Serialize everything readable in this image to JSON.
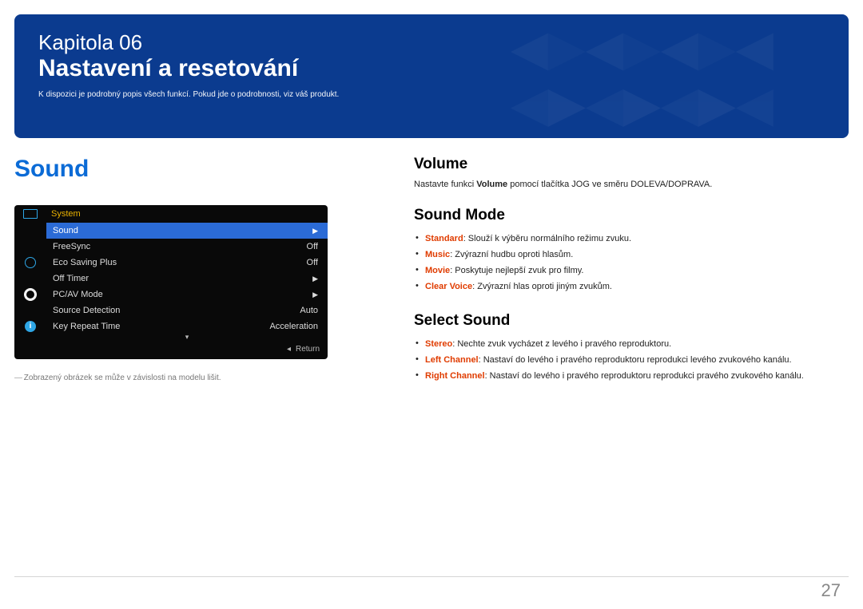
{
  "hero": {
    "chapter": "Kapitola 06",
    "title": "Nastavení a resetování",
    "subtitle": "K dispozici je podrobný popis všech funkcí. Pokud jde o podrobnosti, viz váš produkt."
  },
  "left": {
    "heading": "Sound",
    "osd": {
      "header": "System",
      "rows": [
        {
          "label": "Sound",
          "value": "▶",
          "selected": true
        },
        {
          "label": "FreeSync",
          "value": "Off",
          "selected": false
        },
        {
          "label": "Eco Saving Plus",
          "value": "Off",
          "selected": false
        },
        {
          "label": "Off Timer",
          "value": "▶",
          "selected": false
        },
        {
          "label": "PC/AV Mode",
          "value": "▶",
          "selected": false
        },
        {
          "label": "Source Detection",
          "value": "Auto",
          "selected": false
        },
        {
          "label": "Key Repeat Time",
          "value": "Acceleration",
          "selected": false
        }
      ],
      "return": "Return",
      "info_glyph": "i"
    },
    "footnote_dash": "―",
    "footnote": " Zobrazený obrázek se může v závislosti na modelu lišit."
  },
  "right": {
    "volume": {
      "heading": "Volume",
      "text_pre": "Nastavte funkci ",
      "text_bold": "Volume",
      "text_post": " pomocí tlačítka JOG ve směru DOLEVA/DOPRAVA."
    },
    "sound_mode": {
      "heading": "Sound Mode",
      "items": [
        {
          "key": "Standard",
          "desc": ": Slouží k výběru normálního režimu zvuku."
        },
        {
          "key": "Music",
          "desc": ": Zvýrazní hudbu oproti hlasům."
        },
        {
          "key": "Movie",
          "desc": ": Poskytuje nejlepší zvuk pro filmy."
        },
        {
          "key": "Clear Voice",
          "desc": ": Zvýrazní hlas oproti jiným zvukům."
        }
      ]
    },
    "select_sound": {
      "heading": "Select Sound",
      "items": [
        {
          "key": "Stereo",
          "desc": ": Nechte zvuk vycházet z levého i pravého reproduktoru."
        },
        {
          "key": "Left Channel",
          "desc": ": Nastaví do levého i pravého reproduktoru reprodukci levého zvukového kanálu."
        },
        {
          "key": "Right Channel",
          "desc": ": Nastaví do levého i pravého reproduktoru reprodukci pravého zvukového kanálu."
        }
      ]
    }
  },
  "page_number": "27"
}
